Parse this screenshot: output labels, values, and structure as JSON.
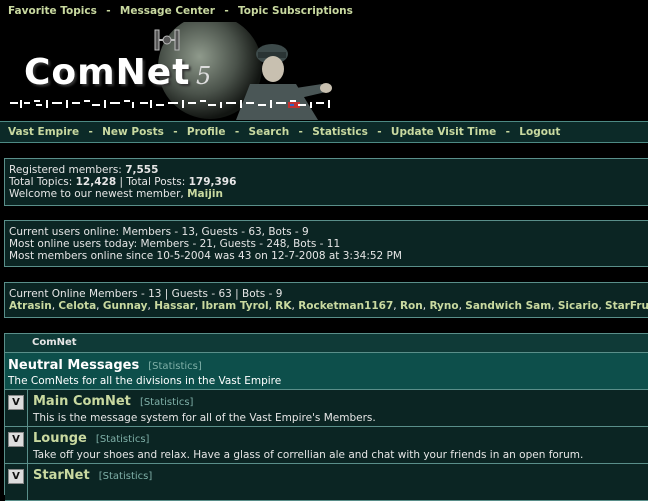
{
  "topbar": {
    "links": [
      "Favorite Topics",
      "Message Center",
      "Topic Subscriptions"
    ],
    "separator": "-"
  },
  "banner": {
    "logo_main": "ComNet",
    "logo_version": "5"
  },
  "navbar": {
    "links": [
      "Vast Empire",
      "New Posts",
      "Profile",
      "Search",
      "Statistics",
      "Update Visit Time",
      "Logout"
    ],
    "separator": "-"
  },
  "stats": {
    "registered_label": "Registered members:",
    "registered_value": "7,555",
    "topics_label": "Total Topics:",
    "topics_value": "12,428",
    "divider": "|",
    "posts_label": "Total Posts:",
    "posts_value": "179,396",
    "welcome_text": "Welcome to our newest member,",
    "newest_member": "Maijin"
  },
  "online": {
    "line1": "Current users online:  Members - 13, Guests - 63, Bots - 9",
    "line2": "Most online users today:  Members - 21, Guests - 248, Bots - 11",
    "line3": "Most members online since 10-5-2004 was 43 on 12-7-2008 at 3:34:52 PM"
  },
  "members_online": {
    "summary": "Current Online Members - 13  |  Guests - 63  |  Bots - 9",
    "names": [
      "Atrasin",
      "Celota",
      "Gunnay",
      "Hassar",
      "Ibram Tyrol",
      "RK",
      "Rocketman1167",
      "Ron",
      "Ryno",
      "Sandwich Sam",
      "Sicario",
      "StarFrui"
    ]
  },
  "forums": {
    "header": "ComNet",
    "category": {
      "title": "Neutral Messages",
      "stats_link": "[Statistics]",
      "description": "The ComNets for all the divisions in the Vast Empire"
    },
    "rows": [
      {
        "title": "Main ComNet",
        "stats_link": "[Statistics]",
        "description": "This is the message system for all of the Vast Empire's Members."
      },
      {
        "title": "Lounge",
        "stats_link": "[Statistics]",
        "description": "Take off your shoes and relax. Have a glass of correllian ale and chat with your friends in an open forum."
      },
      {
        "title": "StarNet",
        "stats_link": "[Statistics]",
        "description": ""
      }
    ],
    "icon_glyph": "V"
  },
  "colors": {
    "background": "#000000",
    "panel": "#0b2523",
    "border": "#5a8f8a",
    "link": "#c9d9a0",
    "category": "#0d4f4b"
  }
}
